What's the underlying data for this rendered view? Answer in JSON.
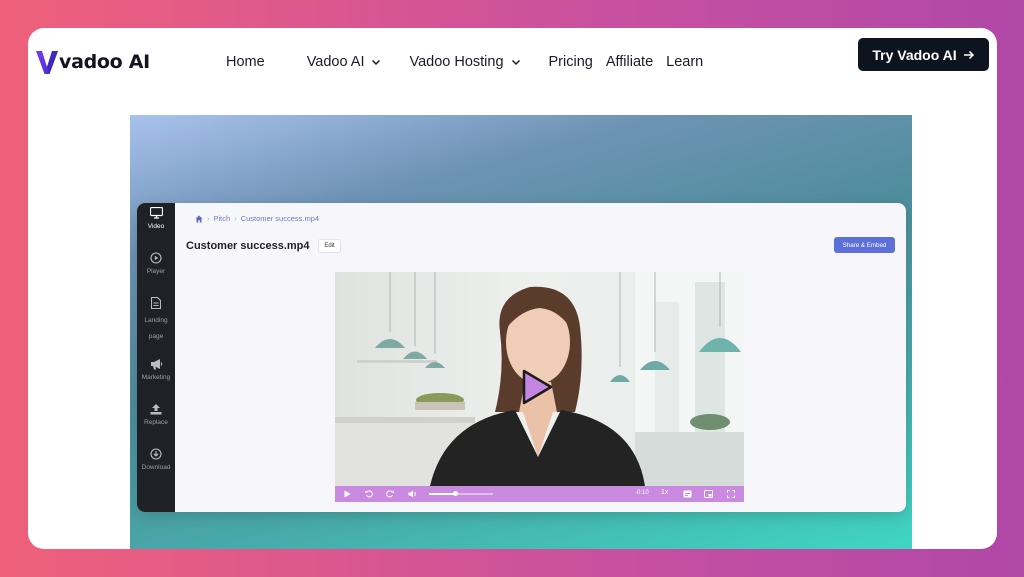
{
  "brand": {
    "name": "vadoo AI",
    "logo_mark": "V",
    "accent": "#6c35e8"
  },
  "nav": {
    "items": [
      {
        "label": "Home",
        "dropdown": false
      },
      {
        "label": "Vadoo AI",
        "dropdown": true
      },
      {
        "label": "Vadoo Hosting",
        "dropdown": true
      },
      {
        "label": "Pricing",
        "dropdown": false
      },
      {
        "label": "Affiliate",
        "dropdown": false
      },
      {
        "label": "Learn",
        "dropdown": false
      }
    ],
    "cta_label": "Try Vadoo AI"
  },
  "app": {
    "sidebar": [
      {
        "label": "Video",
        "icon": "monitor-icon",
        "active": true
      },
      {
        "label": "Player",
        "icon": "play-circle-icon",
        "active": false
      },
      {
        "label": "Landing page",
        "icon": "document-icon",
        "active": false
      },
      {
        "label": "Marketing",
        "icon": "megaphone-icon",
        "active": false
      },
      {
        "label": "Replace",
        "icon": "upload-icon",
        "active": false
      },
      {
        "label": "Download",
        "icon": "download-icon",
        "active": false
      }
    ],
    "breadcrumb": [
      "Pitch",
      "Customer success.mp4"
    ],
    "title": "Customer success.mp4",
    "edit_label": "Edit",
    "share_label": "Share & Embed",
    "player": {
      "time_remaining": "-0:10",
      "speed": "1x",
      "progress": 0.4,
      "accent": "#c98ae0"
    }
  }
}
